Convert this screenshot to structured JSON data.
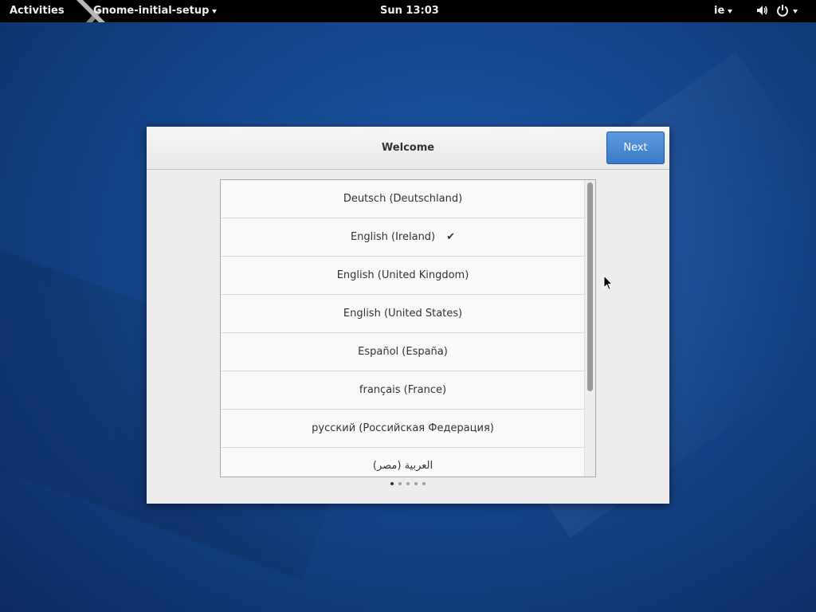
{
  "topbar": {
    "activities": "Activities",
    "app_name": "Gnome-initial-setup",
    "clock": "Sun 13:03",
    "keyboard_layout": "ie",
    "volume_icon": "speaker-icon",
    "power_icon": "power-icon"
  },
  "dialog": {
    "title": "Welcome",
    "next_label": "Next",
    "languages": [
      {
        "label": "Deutsch (Deutschland)",
        "selected": false
      },
      {
        "label": "English (Ireland)",
        "selected": true
      },
      {
        "label": "English (United Kingdom)",
        "selected": false
      },
      {
        "label": "English (United States)",
        "selected": false
      },
      {
        "label": "Español (España)",
        "selected": false
      },
      {
        "label": "français (France)",
        "selected": false
      },
      {
        "label": "русский (Российская Федерация)",
        "selected": false
      },
      {
        "label": "العربية (مصر)",
        "selected": false
      }
    ],
    "check_mark": "✔",
    "pages": 5,
    "current_page": 1
  },
  "colors": {
    "accent": "#4a8ad4",
    "desktop": "#174a94"
  }
}
